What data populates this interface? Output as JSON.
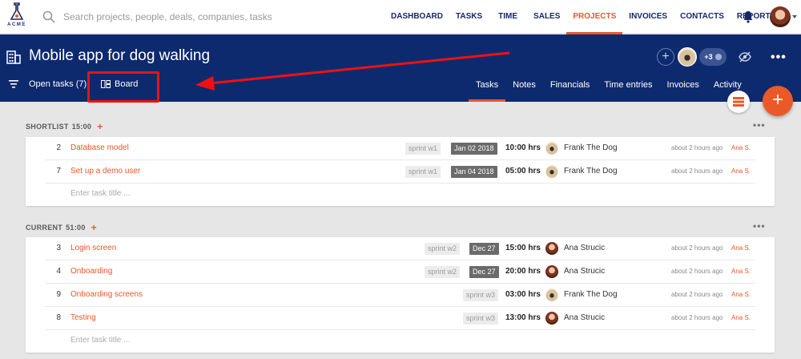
{
  "brand": {
    "logo_text": "ACME"
  },
  "search": {
    "placeholder": "Search projects, people, deals, companies, tasks"
  },
  "nav": {
    "links": [
      "DASHBOARD",
      "TASKS",
      "TIME",
      "SALES",
      "PROJECTS",
      "INVOICES",
      "CONTACTS",
      "REPORTS"
    ],
    "active": "PROJECTS"
  },
  "project": {
    "title": "Mobile app for dog walking",
    "members_extra": "+3",
    "open_tasks": "Open tasks (7)",
    "board_label": "Board",
    "tabs": [
      "Tasks",
      "Notes",
      "Financials",
      "Time entries",
      "Invoices",
      "Activity"
    ],
    "active_tab": "Tasks"
  },
  "fab": {
    "add": "+"
  },
  "sections": [
    {
      "name": "SHORTLIST",
      "time": "15:00",
      "tasks": [
        {
          "num": "2",
          "name": "Database model",
          "tag": "sprint w1",
          "due": "Jan 02 2018",
          "hours": "10:00 hrs",
          "assignee": "Frank The Dog",
          "ago": "about 2 hours ago",
          "by": "Ana S."
        },
        {
          "num": "7",
          "name": "Set up a demo user",
          "tag": "sprint w1",
          "due": "Jan 04 2018",
          "hours": "05:00 hrs",
          "assignee": "Frank The Dog",
          "ago": "about 2 hours ago",
          "by": "Ana S."
        }
      ],
      "new_task_placeholder": "Enter task title ..."
    },
    {
      "name": "CURRENT",
      "time": "51:00",
      "tasks": [
        {
          "num": "3",
          "name": "Login screen",
          "tag": "sprint w2",
          "due": "Dec 27",
          "hours": "15:00 hrs",
          "assignee": "Ana Strucic",
          "ago": "about 2 hours ago",
          "by": "Ana S."
        },
        {
          "num": "4",
          "name": "Onboarding",
          "tag": "sprint w2",
          "due": "Dec 27",
          "hours": "20:00 hrs",
          "assignee": "Ana Strucic",
          "ago": "about 2 hours ago",
          "by": "Ana S."
        },
        {
          "num": "9",
          "name": "Onboarding screens",
          "tag": "sprint w3",
          "due": "",
          "hours": "03:00 hrs",
          "assignee": "Frank The Dog",
          "ago": "about 2 hours ago",
          "by": "Ana S."
        },
        {
          "num": "8",
          "name": "Testing",
          "tag": "sprint w3",
          "due": "",
          "hours": "13:00 hrs",
          "assignee": "Ana Strucic",
          "ago": "about 2 hours ago",
          "by": "Ana S."
        }
      ],
      "new_task_placeholder": "Enter task title ..."
    }
  ],
  "colors": {
    "header_bg": "#0e2a6e",
    "accent": "#e9572a",
    "annotation": "#e11111"
  }
}
